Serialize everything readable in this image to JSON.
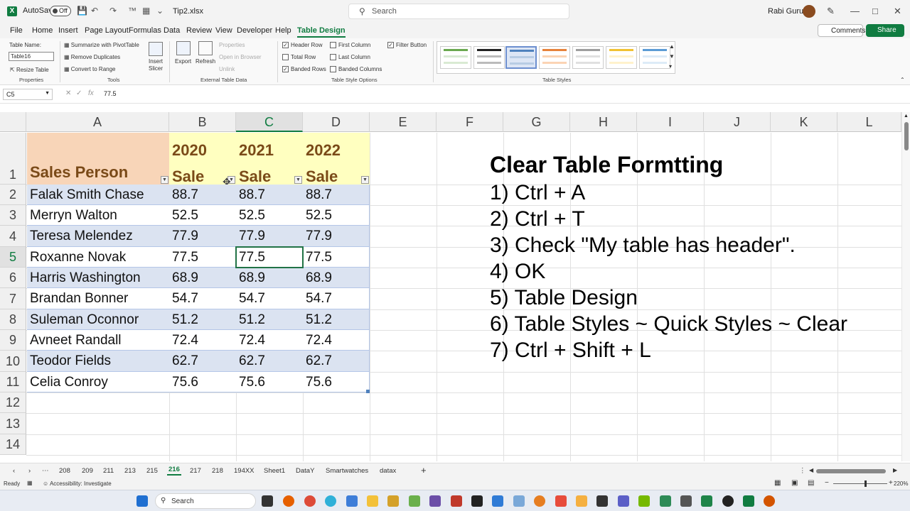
{
  "titlebar": {
    "autosave_label": "AutoSave",
    "autosave_state": "Off",
    "filename": "Tip2.xlsx",
    "search_placeholder": "Search",
    "user_name": "Rabi Gurung",
    "save_icon": "save-icon",
    "undo_icon": "undo-icon",
    "redo_icon": "redo-icon"
  },
  "ribbon_tabs": [
    "File",
    "Home",
    "Insert",
    "Page Layout",
    "Formulas",
    "Data",
    "Review",
    "View",
    "Developer",
    "Help",
    "Table Design"
  ],
  "active_tab": "Table Design",
  "comments_label": "Comments",
  "share_label": "Share",
  "ribbon": {
    "properties": {
      "table_name_label": "Table Name:",
      "table_name_value": "Table16",
      "resize_label": "Resize Table",
      "group_label": "Properties"
    },
    "tools": {
      "summarize_label": "Summarize with PivotTable",
      "remove_dup_label": "Remove Duplicates",
      "convert_label": "Convert to Range",
      "insert_slicer_label": "Insert",
      "insert_slicer_label2": "Slicer",
      "group_label": "Tools"
    },
    "external": {
      "export_label": "Export",
      "refresh_label": "Refresh",
      "properties_label": "Properties",
      "open_browser_label": "Open in Browser",
      "unlink_label": "Unlink",
      "group_label": "External Table Data"
    },
    "style_options": {
      "header_row": "Header Row",
      "total_row": "Total Row",
      "banded_rows": "Banded Rows",
      "first_column": "First Column",
      "last_column": "Last Column",
      "banded_columns": "Banded Columns",
      "filter_button": "Filter Button",
      "group_label": "Table Style Options",
      "checked": {
        "header_row": true,
        "total_row": false,
        "banded_rows": true,
        "first_column": false,
        "last_column": false,
        "banded_columns": false,
        "filter_button": true
      }
    },
    "styles": {
      "group_label": "Table Styles",
      "swatch_colors": [
        "#6aa84f",
        "#222222",
        "#4f81bd",
        "#e6823a",
        "#9e9e9e",
        "#f1c232",
        "#5b9bd5"
      ],
      "selected_index": 2
    }
  },
  "formula_bar": {
    "name_box": "C5",
    "fx_label": "fx",
    "value": "77.5"
  },
  "columns": [
    "A",
    "B",
    "C",
    "D",
    "E",
    "F",
    "G",
    "H",
    "I",
    "J",
    "K",
    "L"
  ],
  "active_column": "C",
  "rows": [
    "1",
    "2",
    "3",
    "4",
    "5",
    "6",
    "7",
    "8",
    "9",
    "10",
    "11",
    "12",
    "13",
    "14"
  ],
  "active_row": "5",
  "table": {
    "headers": [
      {
        "line1": "",
        "line2": "Sales Person"
      },
      {
        "line1": "2020",
        "line2": "Sale"
      },
      {
        "line1": "2021",
        "line2": "Sale"
      },
      {
        "line1": "2022",
        "line2": "Sale"
      }
    ],
    "data": [
      [
        "Falak Smith Chase",
        "88.7",
        "88.7",
        "88.7"
      ],
      [
        "Merryn Walton",
        "52.5",
        "52.5",
        "52.5"
      ],
      [
        "Teresa Melendez",
        "77.9",
        "77.9",
        "77.9"
      ],
      [
        "Roxanne Novak",
        "77.5",
        "77.5",
        "77.5"
      ],
      [
        "Harris Washington",
        "68.9",
        "68.9",
        "68.9"
      ],
      [
        "Brandan Bonner",
        "54.7",
        "54.7",
        "54.7"
      ],
      [
        "Suleman Oconnor",
        "51.2",
        "51.2",
        "51.2"
      ],
      [
        "Avneet Randall",
        "72.4",
        "72.4",
        "72.4"
      ],
      [
        "Teodor Fields",
        "62.7",
        "62.7",
        "62.7"
      ],
      [
        "Celia Conroy",
        "75.6",
        "75.6",
        "75.6"
      ]
    ],
    "colors": {
      "header_a": "#f8d5b8",
      "header_bcd": "#ffffc0",
      "band": "#dbe3f1",
      "plain": "#ffffff"
    }
  },
  "notes": {
    "title": "Clear Table Formtting",
    "steps": [
      "1) Ctrl + A",
      "2) Ctrl + T",
      "3) Check \"My table has header\".",
      "4) OK",
      "5) Table Design",
      "6) Table Styles ~ Quick Styles ~ Clear",
      "7) Ctrl + Shift + L"
    ]
  },
  "sheet_tabs": [
    "208",
    "209",
    "211",
    "213",
    "215",
    "216",
    "217",
    "218",
    "194XX",
    "Sheet1",
    "DataY",
    "Smartwatches",
    "datax"
  ],
  "active_sheet": "216",
  "status": {
    "ready": "Ready",
    "accessibility": "Accessibility: Investigate",
    "zoom": "220%"
  },
  "taskbar": {
    "search_placeholder": "Search"
  }
}
